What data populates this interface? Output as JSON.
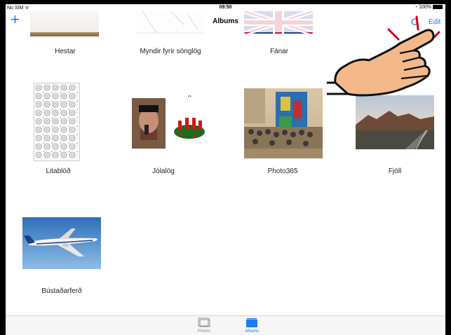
{
  "status_bar": {
    "carrier": "No SIM",
    "time": "09:50",
    "battery": "100%"
  },
  "nav": {
    "title": "Albums",
    "edit_label": "Edit",
    "add_icon": "plus-icon",
    "search_icon": "search-icon"
  },
  "albums": [
    {
      "name": "Hestar"
    },
    {
      "name": "Myndir fyrir sönglög"
    },
    {
      "name": "Fánar"
    },
    {
      "name": "Litablöð"
    },
    {
      "name": "Jólalög"
    },
    {
      "name": "Photo365"
    },
    {
      "name": "Fjöll"
    },
    {
      "name": "Bústaðarferð"
    }
  ],
  "tabs": [
    {
      "label": "Photos",
      "icon": "photos-icon",
      "active": false
    },
    {
      "label": "Albums",
      "icon": "albums-icon",
      "active": true
    }
  ],
  "colors": {
    "accent": "#1a7cf5",
    "tabbar_bg": "#f6f6f7",
    "label_inactive": "#8e8e93"
  }
}
